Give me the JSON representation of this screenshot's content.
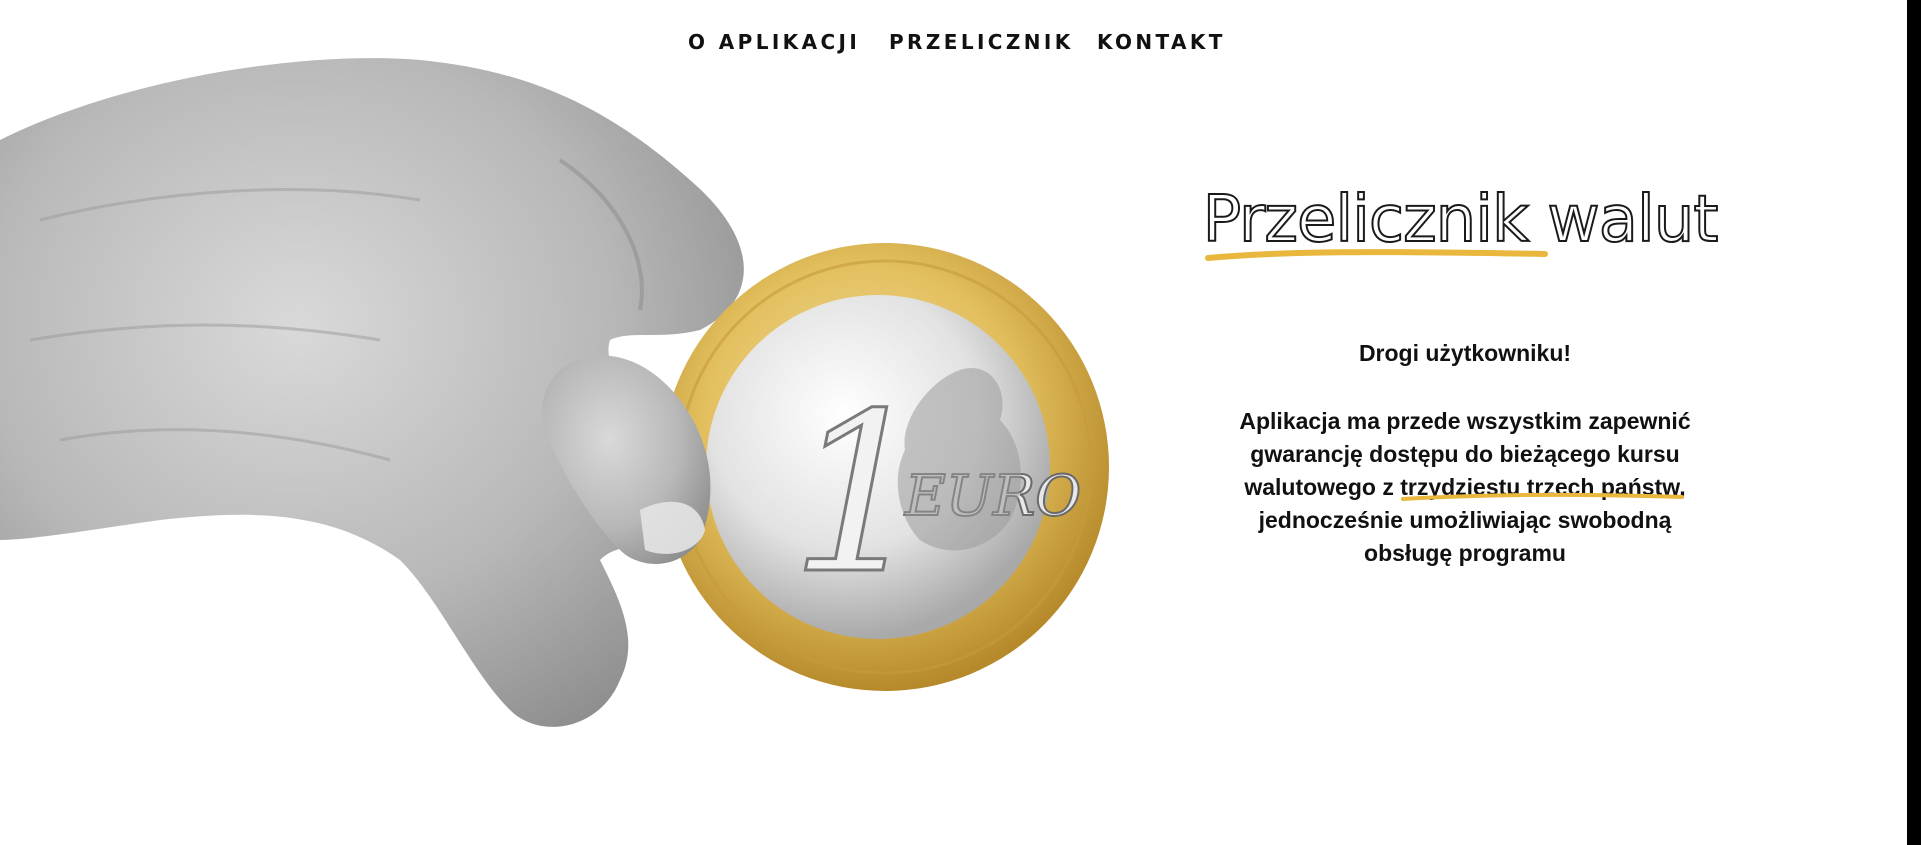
{
  "nav": {
    "items": [
      {
        "label": "O APLIKACJI"
      },
      {
        "label": "PRZELICZNIK"
      },
      {
        "label": "KONTAKT"
      }
    ]
  },
  "hero": {
    "coin": {
      "denomination": "1",
      "text": "EURO"
    },
    "title": "Przelicznik walut",
    "greeting": "Drogi użytkowniku!",
    "description": {
      "line1": "Aplikacja ma przede wszystkim zapewnić",
      "line2": "gwarancję dostępu do bieżącego kursu",
      "line3_pre": "walutowego z ",
      "line3_highlight": "trzydziestu trzech państw",
      "line3_post": ",",
      "line4": "jednocześnie umożliwiając swobodną",
      "line5": "obsługę programu"
    }
  },
  "colors": {
    "accent": "#e8b73c",
    "text": "#111111",
    "coin_gold": "#d9b45a",
    "coin_silver": "#dcdcdc"
  }
}
